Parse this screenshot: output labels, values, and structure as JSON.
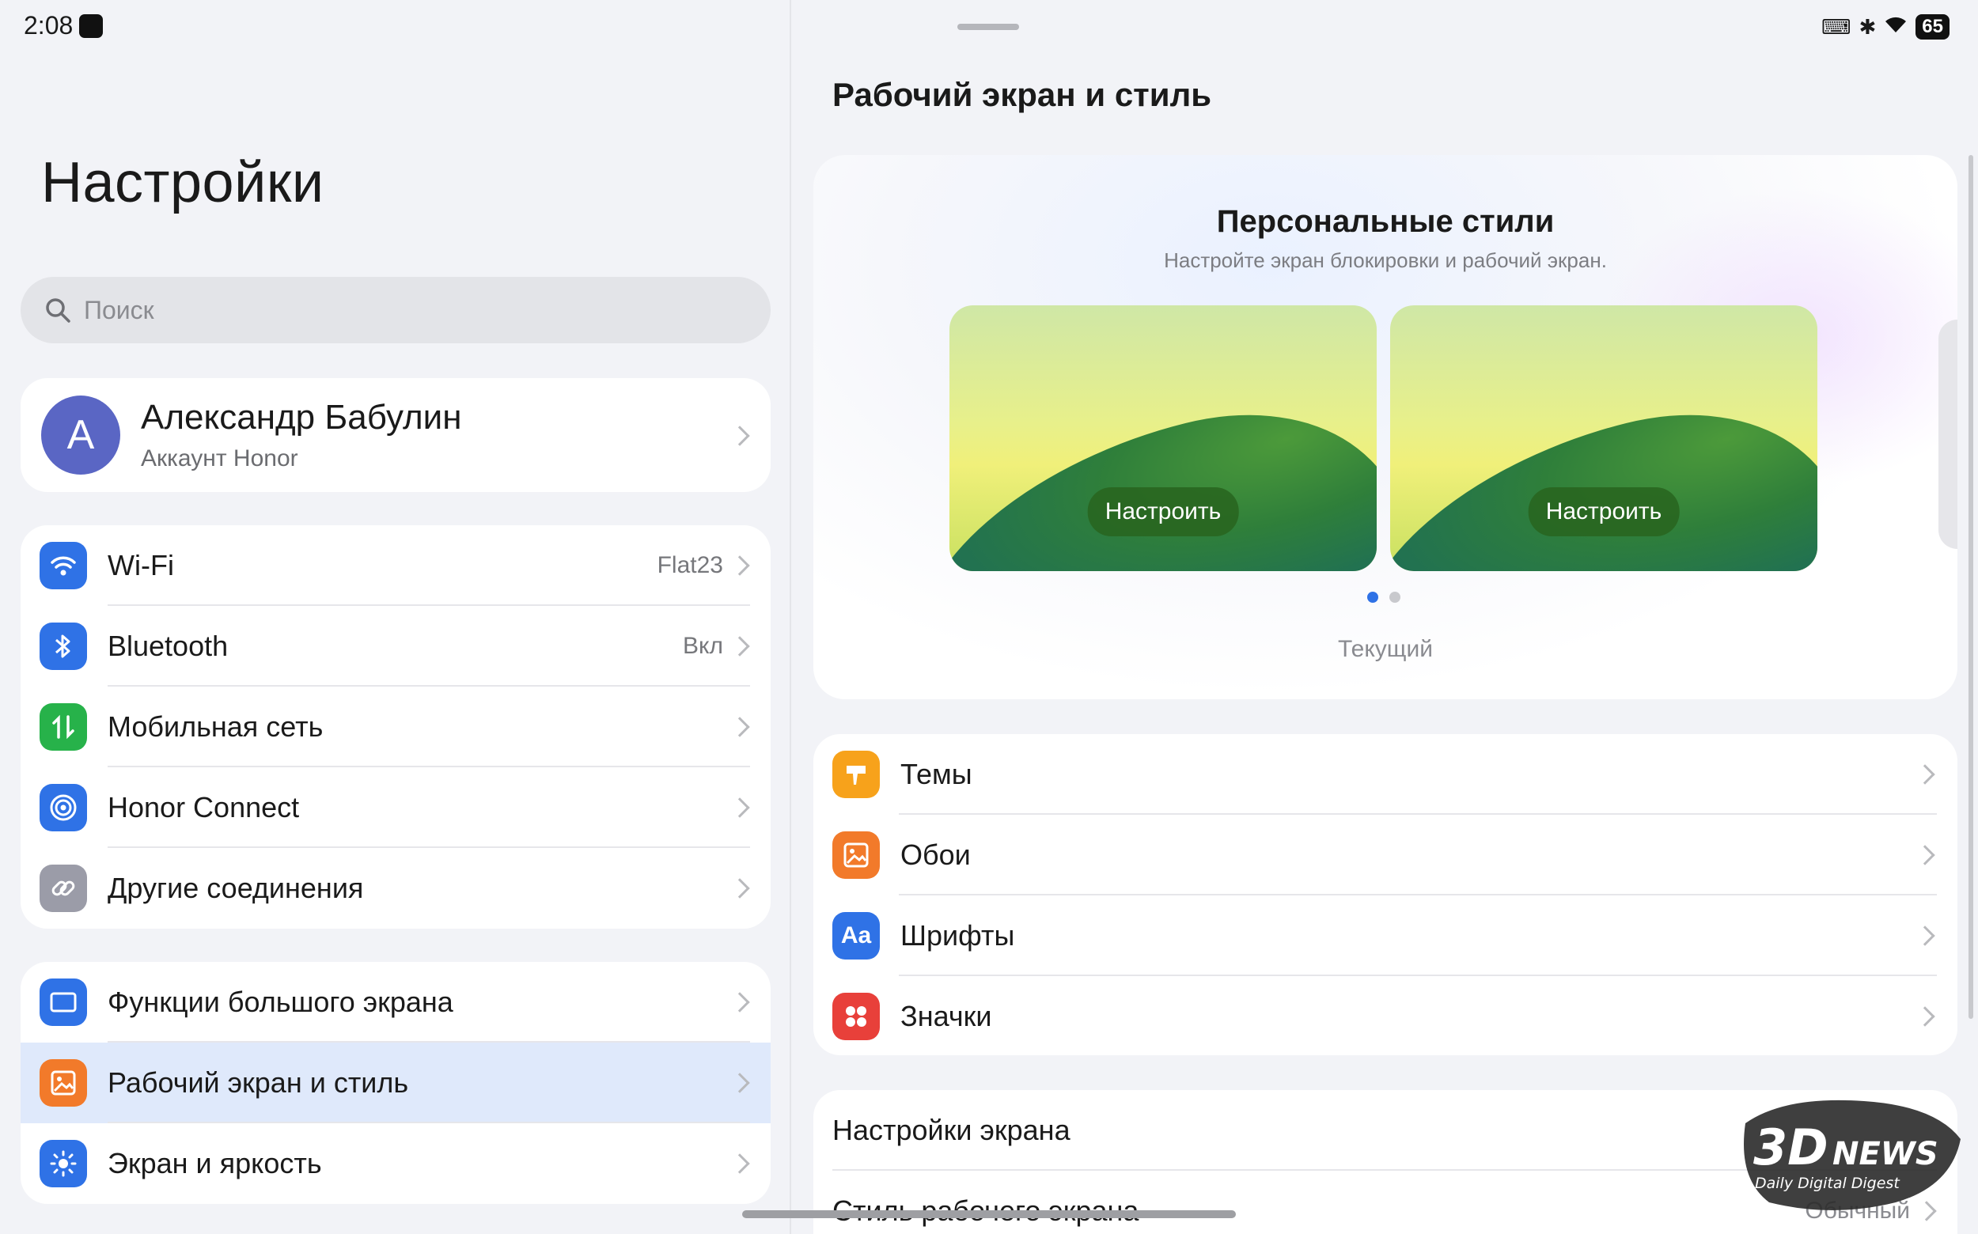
{
  "status": {
    "time": "2:08",
    "battery": "65"
  },
  "left": {
    "title": "Настройки",
    "search_placeholder": "Поиск",
    "profile": {
      "initial": "A",
      "name": "Александр Бабулин",
      "subtitle": "Аккаунт Honor"
    },
    "group1": [
      {
        "label": "Wi-Fi",
        "value": "Flat23",
        "icon": "wifi-icon",
        "color": "#2f72e6"
      },
      {
        "label": "Bluetooth",
        "value": "Вкл",
        "icon": "bluetooth-icon",
        "color": "#2f72e6"
      },
      {
        "label": "Мобильная сеть",
        "value": "",
        "icon": "mobile-data-icon",
        "color": "#27b24a"
      },
      {
        "label": "Honor Connect",
        "value": "",
        "icon": "honor-connect-icon",
        "color": "#2f72e6"
      },
      {
        "label": "Другие соединения",
        "value": "",
        "icon": "link-icon",
        "color": "#9b9ca8"
      }
    ],
    "group2": [
      {
        "label": "Функции большого экрана",
        "icon": "large-screen-icon",
        "color": "#2f72e6"
      },
      {
        "label": "Рабочий экран и стиль",
        "icon": "home-screen-style-icon",
        "color": "#f27a2a",
        "selected": true
      },
      {
        "label": "Экран и яркость",
        "icon": "brightness-icon",
        "color": "#2f72e6"
      }
    ]
  },
  "right": {
    "title": "Рабочий экран и стиль",
    "styles": {
      "title": "Персональные стили",
      "subtitle": "Настройте экран блокировки и рабочий экран.",
      "customize_label_1": "Настроить",
      "customize_label_2": "Настроить",
      "current_label": "Текущий"
    },
    "list": [
      {
        "label": "Темы",
        "icon": "themes-icon",
        "color": "#f7a21b"
      },
      {
        "label": "Обои",
        "icon": "wallpaper-icon",
        "color": "#f27a2a"
      },
      {
        "label": "Шрифты",
        "icon": "fonts-icon",
        "color": "#2f72e6",
        "glyph": "Aa"
      },
      {
        "label": "Значки",
        "icon": "icons-icon",
        "color": "#e8403a"
      }
    ],
    "bottom": [
      {
        "label": "Настройки экрана",
        "value": ""
      },
      {
        "label": "Стиль рабочего экрана",
        "value": "Обычный"
      }
    ]
  },
  "watermark": {
    "brand": "3DNEWS",
    "tagline": "Daily Digital Digest"
  }
}
